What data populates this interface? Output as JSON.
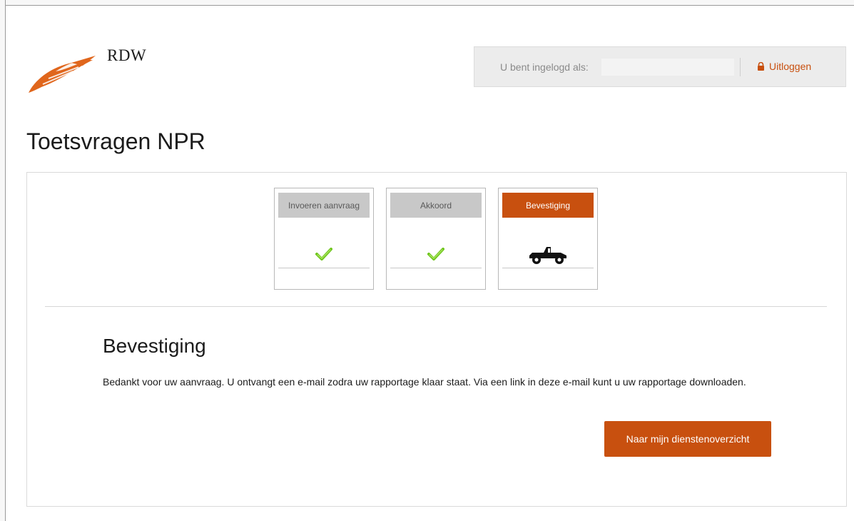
{
  "brand": {
    "name": "RDW",
    "color": "#c8500f"
  },
  "header": {
    "login_label": "U bent ingelogd als:",
    "login_user": "",
    "logout_label": "Uitloggen",
    "logout_icon": "lock-icon"
  },
  "page": {
    "title": "Toetsvragen NPR"
  },
  "steps": [
    {
      "label": "Invoeren aanvraag",
      "state": "completed",
      "icon": "check-icon"
    },
    {
      "label": "Akkoord",
      "state": "completed",
      "icon": "check-icon"
    },
    {
      "label": "Bevestiging",
      "state": "active",
      "icon": "jeep-icon"
    }
  ],
  "confirmation": {
    "title": "Bevestiging",
    "text": "Bedankt voor uw aanvraag. U ontvangt een e-mail zodra uw rapportage klaar staat. Via een link in deze e-mail kunt u uw rapportage downloaden.",
    "button_label": "Naar mijn dienstenoverzicht"
  }
}
